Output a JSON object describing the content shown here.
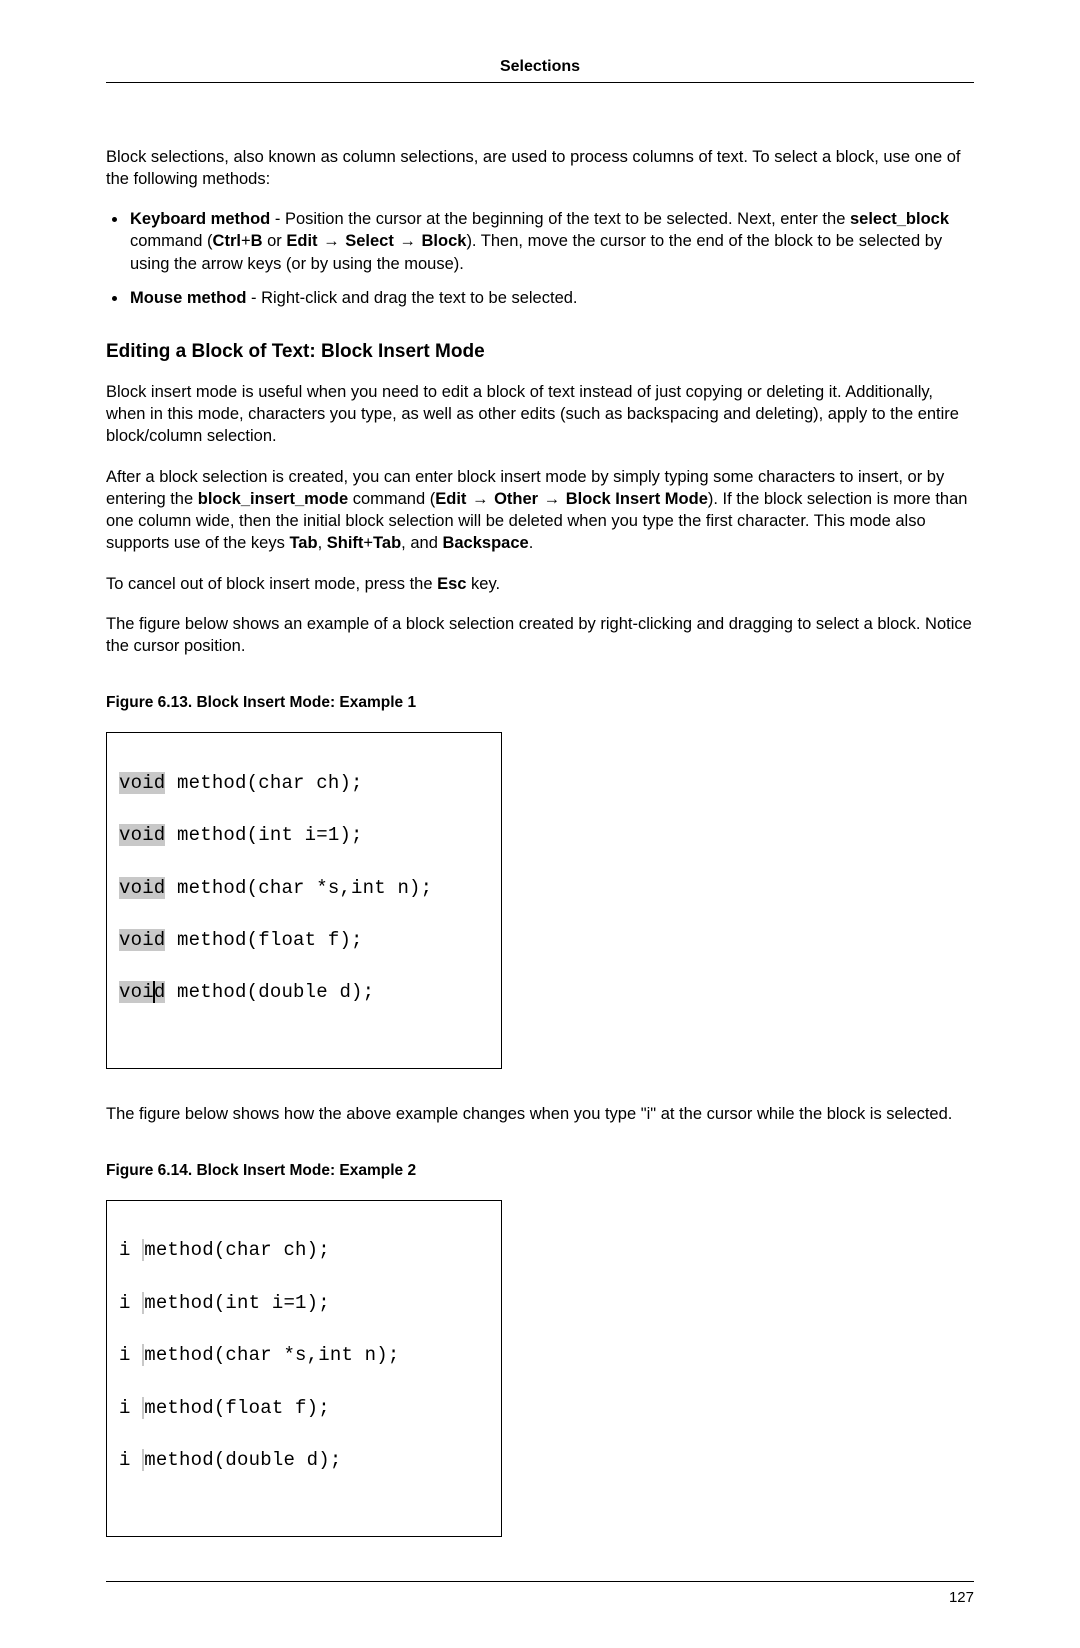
{
  "header": {
    "title": "Selections"
  },
  "intro": "Block selections, also known as column selections, are used to process columns of text. To select a block, use one of the following methods:",
  "bullets": {
    "keyboard": {
      "label": "Keyboard method",
      "t1": " - Position the cursor at the beginning of the text to be selected. Next, enter the ",
      "cmd": "select_block",
      "t2": " command (",
      "kb": "Ctrl",
      "plus1": "+",
      "kb2": "B",
      "or": " or ",
      "m1": "Edit",
      "arrow": " → ",
      "m2": "Select",
      "m3": "Block",
      "t3": "). Then, move the cursor to the end of the block to be selected by using the arrow keys (or by using the mouse)."
    },
    "mouse": {
      "label": "Mouse method",
      "t1": " - Right-click and drag the text to be selected."
    }
  },
  "section_title": "Editing a Block of Text: Block Insert Mode",
  "p1": "Block insert mode is useful when you need to edit a block of text instead of just copying or deleting it. Additionally, when in this mode, characters you type, as well as other edits (such as backspacing and deleting), apply to the entire block/column selection.",
  "p2": {
    "t1": "After a block selection is created, you can enter block insert mode by simply typing some characters to insert, or by entering the ",
    "cmd": "block_insert_mode",
    "t2": " command (",
    "m1": "Edit",
    "arrow": " → ",
    "m2": "Other",
    "m3": "Block Insert Mode",
    "t3": "). If the block selection is more than one column wide, then the initial block selection will be deleted when you type the first character. This mode also supports use of the keys ",
    "k1": "Tab",
    "c1": ", ",
    "k2": "Shift",
    "plus": "+",
    "k3": "Tab",
    "c2": ", and ",
    "k4": "Backspace",
    "dot": "."
  },
  "p3": {
    "t1": "To cancel out of block insert mode, press the ",
    "esc": "Esc",
    "t2": " key."
  },
  "p4": "The figure below shows an example of a block selection created by right-clicking and dragging to select a block. Notice the cursor position.",
  "fig1": {
    "caption": "Figure 6.13.  Block Insert Mode: Example 1",
    "lines": [
      {
        "sel": "void",
        "rest": " method(char ch);"
      },
      {
        "sel": "void",
        "rest": " method(int i=1);"
      },
      {
        "sel": "void",
        "rest": " method(char *s,int n);"
      },
      {
        "sel": "void",
        "rest": " method(float f);"
      },
      {
        "sel_a": "voi",
        "sel_b": "d",
        "rest": " method(double d);"
      }
    ]
  },
  "p5": "The figure below shows how the above example changes when you type \"i\" at the cursor while the block is selected.",
  "fig2": {
    "caption": "Figure 6.14.  Block Insert Mode: Example 2",
    "lines": [
      {
        "pre": "i ",
        "rest": "method(char ch);"
      },
      {
        "pre": "i ",
        "rest": "method(int i=1);"
      },
      {
        "pre": "i ",
        "rest": "method(char *s,int n);"
      },
      {
        "pre": "i ",
        "rest": "method(float f);"
      },
      {
        "pre": "i ",
        "rest": "method(double d);"
      }
    ]
  },
  "page_number": "127"
}
